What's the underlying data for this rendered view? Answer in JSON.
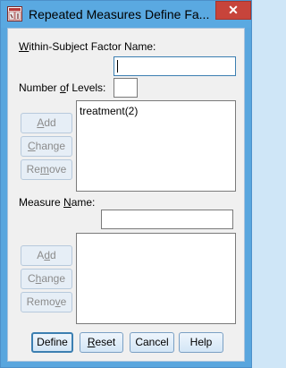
{
  "window": {
    "title": "Repeated Measures Define Fa...",
    "close_glyph": "✕"
  },
  "factor": {
    "name_label_pre": "",
    "name_label_u": "W",
    "name_label_post": "ithin-Subject Factor Name:",
    "name_value": "",
    "levels_label_pre": "Number ",
    "levels_label_u": "o",
    "levels_label_post": "f Levels:",
    "levels_value": "",
    "list_items": [
      "treatment(2)"
    ],
    "add_pre": "",
    "add_u": "A",
    "add_post": "dd",
    "change_pre": "",
    "change_u": "C",
    "change_post": "hange",
    "remove_pre": "Re",
    "remove_u": "m",
    "remove_post": "ove"
  },
  "measure": {
    "name_label_pre": "Measure ",
    "name_label_u": "N",
    "name_label_post": "ame:",
    "name_value": "",
    "list_items": [],
    "add_pre": "A",
    "add_u": "d",
    "add_post": "d",
    "change_pre": "C",
    "change_u": "h",
    "change_post": "ange",
    "remove_pre": "Remo",
    "remove_u": "v",
    "remove_post": "e"
  },
  "footer": {
    "define": "Define",
    "reset_pre": "",
    "reset_u": "R",
    "reset_post": "eset",
    "cancel": "Cancel",
    "help": "Help"
  },
  "colors": {
    "title_bar": "#5aa9e1",
    "close_button": "#c7443b",
    "dialog_bg": "#f0f0f0",
    "focus_border": "#3c7fb1"
  }
}
